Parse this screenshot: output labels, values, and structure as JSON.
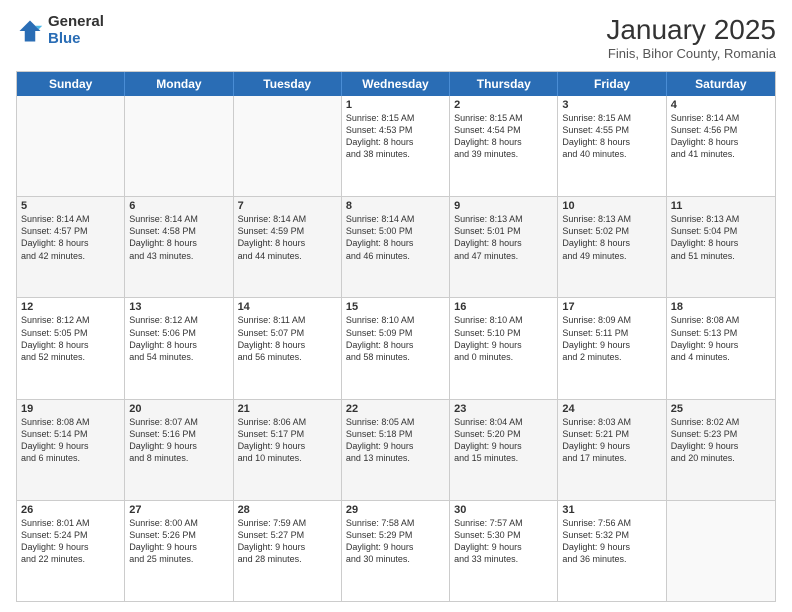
{
  "logo": {
    "general": "General",
    "blue": "Blue"
  },
  "title": "January 2025",
  "subtitle": "Finis, Bihor County, Romania",
  "header": {
    "days": [
      "Sunday",
      "Monday",
      "Tuesday",
      "Wednesday",
      "Thursday",
      "Friday",
      "Saturday"
    ]
  },
  "rows": [
    [
      {
        "day": "",
        "empty": true
      },
      {
        "day": "",
        "empty": true
      },
      {
        "day": "",
        "empty": true
      },
      {
        "day": "1",
        "lines": [
          "Sunrise: 8:15 AM",
          "Sunset: 4:53 PM",
          "Daylight: 8 hours",
          "and 38 minutes."
        ]
      },
      {
        "day": "2",
        "lines": [
          "Sunrise: 8:15 AM",
          "Sunset: 4:54 PM",
          "Daylight: 8 hours",
          "and 39 minutes."
        ]
      },
      {
        "day": "3",
        "lines": [
          "Sunrise: 8:15 AM",
          "Sunset: 4:55 PM",
          "Daylight: 8 hours",
          "and 40 minutes."
        ]
      },
      {
        "day": "4",
        "lines": [
          "Sunrise: 8:14 AM",
          "Sunset: 4:56 PM",
          "Daylight: 8 hours",
          "and 41 minutes."
        ]
      }
    ],
    [
      {
        "day": "5",
        "lines": [
          "Sunrise: 8:14 AM",
          "Sunset: 4:57 PM",
          "Daylight: 8 hours",
          "and 42 minutes."
        ]
      },
      {
        "day": "6",
        "lines": [
          "Sunrise: 8:14 AM",
          "Sunset: 4:58 PM",
          "Daylight: 8 hours",
          "and 43 minutes."
        ]
      },
      {
        "day": "7",
        "lines": [
          "Sunrise: 8:14 AM",
          "Sunset: 4:59 PM",
          "Daylight: 8 hours",
          "and 44 minutes."
        ]
      },
      {
        "day": "8",
        "lines": [
          "Sunrise: 8:14 AM",
          "Sunset: 5:00 PM",
          "Daylight: 8 hours",
          "and 46 minutes."
        ]
      },
      {
        "day": "9",
        "lines": [
          "Sunrise: 8:13 AM",
          "Sunset: 5:01 PM",
          "Daylight: 8 hours",
          "and 47 minutes."
        ]
      },
      {
        "day": "10",
        "lines": [
          "Sunrise: 8:13 AM",
          "Sunset: 5:02 PM",
          "Daylight: 8 hours",
          "and 49 minutes."
        ]
      },
      {
        "day": "11",
        "lines": [
          "Sunrise: 8:13 AM",
          "Sunset: 5:04 PM",
          "Daylight: 8 hours",
          "and 51 minutes."
        ]
      }
    ],
    [
      {
        "day": "12",
        "lines": [
          "Sunrise: 8:12 AM",
          "Sunset: 5:05 PM",
          "Daylight: 8 hours",
          "and 52 minutes."
        ]
      },
      {
        "day": "13",
        "lines": [
          "Sunrise: 8:12 AM",
          "Sunset: 5:06 PM",
          "Daylight: 8 hours",
          "and 54 minutes."
        ]
      },
      {
        "day": "14",
        "lines": [
          "Sunrise: 8:11 AM",
          "Sunset: 5:07 PM",
          "Daylight: 8 hours",
          "and 56 minutes."
        ]
      },
      {
        "day": "15",
        "lines": [
          "Sunrise: 8:10 AM",
          "Sunset: 5:09 PM",
          "Daylight: 8 hours",
          "and 58 minutes."
        ]
      },
      {
        "day": "16",
        "lines": [
          "Sunrise: 8:10 AM",
          "Sunset: 5:10 PM",
          "Daylight: 9 hours",
          "and 0 minutes."
        ]
      },
      {
        "day": "17",
        "lines": [
          "Sunrise: 8:09 AM",
          "Sunset: 5:11 PM",
          "Daylight: 9 hours",
          "and 2 minutes."
        ]
      },
      {
        "day": "18",
        "lines": [
          "Sunrise: 8:08 AM",
          "Sunset: 5:13 PM",
          "Daylight: 9 hours",
          "and 4 minutes."
        ]
      }
    ],
    [
      {
        "day": "19",
        "lines": [
          "Sunrise: 8:08 AM",
          "Sunset: 5:14 PM",
          "Daylight: 9 hours",
          "and 6 minutes."
        ]
      },
      {
        "day": "20",
        "lines": [
          "Sunrise: 8:07 AM",
          "Sunset: 5:16 PM",
          "Daylight: 9 hours",
          "and 8 minutes."
        ]
      },
      {
        "day": "21",
        "lines": [
          "Sunrise: 8:06 AM",
          "Sunset: 5:17 PM",
          "Daylight: 9 hours",
          "and 10 minutes."
        ]
      },
      {
        "day": "22",
        "lines": [
          "Sunrise: 8:05 AM",
          "Sunset: 5:18 PM",
          "Daylight: 9 hours",
          "and 13 minutes."
        ]
      },
      {
        "day": "23",
        "lines": [
          "Sunrise: 8:04 AM",
          "Sunset: 5:20 PM",
          "Daylight: 9 hours",
          "and 15 minutes."
        ]
      },
      {
        "day": "24",
        "lines": [
          "Sunrise: 8:03 AM",
          "Sunset: 5:21 PM",
          "Daylight: 9 hours",
          "and 17 minutes."
        ]
      },
      {
        "day": "25",
        "lines": [
          "Sunrise: 8:02 AM",
          "Sunset: 5:23 PM",
          "Daylight: 9 hours",
          "and 20 minutes."
        ]
      }
    ],
    [
      {
        "day": "26",
        "lines": [
          "Sunrise: 8:01 AM",
          "Sunset: 5:24 PM",
          "Daylight: 9 hours",
          "and 22 minutes."
        ]
      },
      {
        "day": "27",
        "lines": [
          "Sunrise: 8:00 AM",
          "Sunset: 5:26 PM",
          "Daylight: 9 hours",
          "and 25 minutes."
        ]
      },
      {
        "day": "28",
        "lines": [
          "Sunrise: 7:59 AM",
          "Sunset: 5:27 PM",
          "Daylight: 9 hours",
          "and 28 minutes."
        ]
      },
      {
        "day": "29",
        "lines": [
          "Sunrise: 7:58 AM",
          "Sunset: 5:29 PM",
          "Daylight: 9 hours",
          "and 30 minutes."
        ]
      },
      {
        "day": "30",
        "lines": [
          "Sunrise: 7:57 AM",
          "Sunset: 5:30 PM",
          "Daylight: 9 hours",
          "and 33 minutes."
        ]
      },
      {
        "day": "31",
        "lines": [
          "Sunrise: 7:56 AM",
          "Sunset: 5:32 PM",
          "Daylight: 9 hours",
          "and 36 minutes."
        ]
      },
      {
        "day": "",
        "empty": true
      }
    ]
  ]
}
